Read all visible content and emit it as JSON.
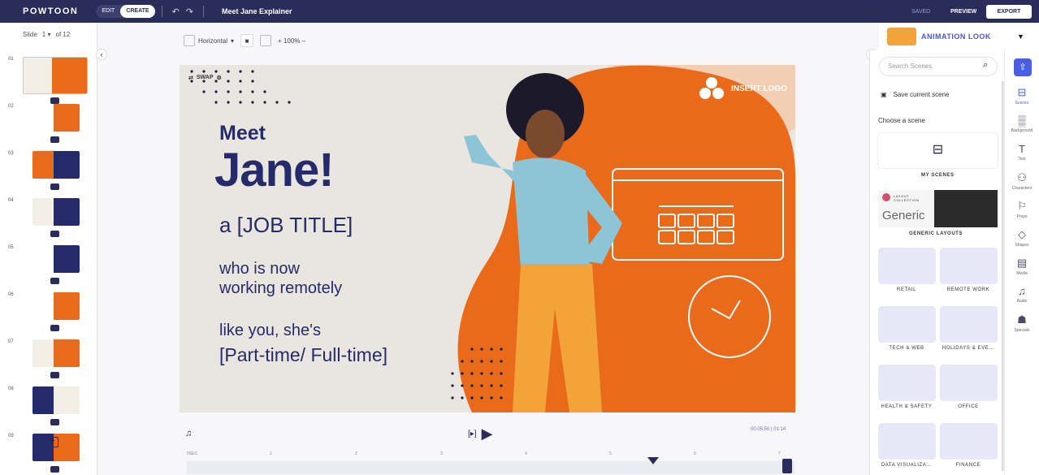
{
  "topbar": {
    "logo": "POWTOON",
    "edit": "EDIT",
    "create": "CREATE",
    "project_title": "Meet Jane Explainer",
    "saved": "SAVED",
    "preview": "PREVIEW",
    "export": "EXPORT"
  },
  "slides": {
    "label": "Slide",
    "current": "1",
    "total": "of 12",
    "numbers": [
      "01",
      "02",
      "03",
      "04",
      "05",
      "06",
      "07",
      "08",
      "09"
    ]
  },
  "canvas_toolbar": {
    "orientation": "Horizontal",
    "zoom": "100%"
  },
  "stage": {
    "swap": "SWAP",
    "meet": "Meet",
    "jane": "Jane!",
    "job": "a [JOB TITLE]",
    "who1": "who is now",
    "who2": "working remotely",
    "like": "like you, she's",
    "part": "[Part-time/ Full-time]",
    "insert_logo": "INSERT LOGO"
  },
  "timeline": {
    "timecode": "00:05:50 | 01:14",
    "ruler": [
      "0SEC",
      "1",
      "2",
      "3",
      "4",
      "5",
      "6",
      "7"
    ]
  },
  "right_panel": {
    "animation_look": "ANIMATION LOOK",
    "search_placeholder": "Search Scenes",
    "save_current": "Save current scene",
    "choose": "Choose a scene",
    "my_scenes": "MY SCENES",
    "layout_collection": "LAYOUT COLLECTION",
    "generic": "Generic",
    "generic_layouts": "GENERIC LAYOUTS",
    "categories": [
      "RETAIL",
      "REMOTE WORK",
      "TECH & WEB",
      "HOLIDAYS & EVE...",
      "HEALTH & SAFETY",
      "OFFICE",
      "DATA VISUALIZA...",
      "FINANCE"
    ]
  },
  "rail": [
    "Scenes",
    "Background",
    "Text",
    "Characters",
    "Props",
    "Shapes",
    "Media",
    "Audio",
    "Specials"
  ],
  "colors": {
    "navy": "#252a6b",
    "orange": "#e86a1a",
    "accent": "#4a5fe0"
  }
}
